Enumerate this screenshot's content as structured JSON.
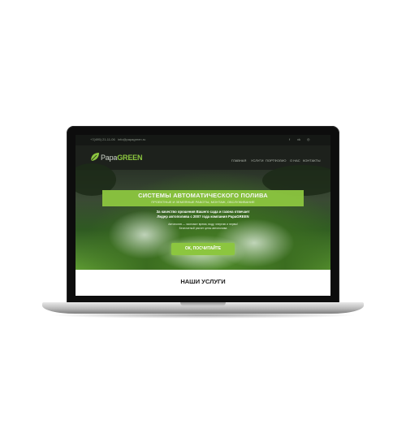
{
  "topbar": {
    "phone": "+7(495) 21-11-06",
    "email": "info@papagreen.ru",
    "social_icons": [
      "facebook-icon",
      "vk-icon",
      "instagram-icon"
    ]
  },
  "header": {
    "logo_light": "Papa",
    "logo_bold": "GREEN",
    "nav": [
      "ГЛАВНАЯ",
      "УСЛУГИ",
      "ПОРТФОЛИО",
      "О НАС",
      "КОНТАКТЫ"
    ]
  },
  "hero": {
    "title": "СИСТЕМЫ АВТОМАТИЧЕСКОГО ПОЛИВА",
    "subtitle": "ПРОЕКТНЫЕ И ЗЕМЛЯНЫЕ РАБОТЫ, МОНТАЖ, ОБСЛУЖИВАНИЕ",
    "lead_1": "За качество орошения Вашего сада и газона отвечает",
    "lead_2": "Лидер автополива с 2007 года компания PapaGREEN",
    "small_1": "Автополив — экономит время, воду, энергию и нервы!",
    "small_2": "Бесплатный расчет цены автополива",
    "cta": "ОК, ПОСЧИТАЙТЕ"
  },
  "services": {
    "title": "НАШИ УСЛУГИ"
  },
  "colors": {
    "accent": "#8cc63f",
    "dark": "#1d211c"
  }
}
